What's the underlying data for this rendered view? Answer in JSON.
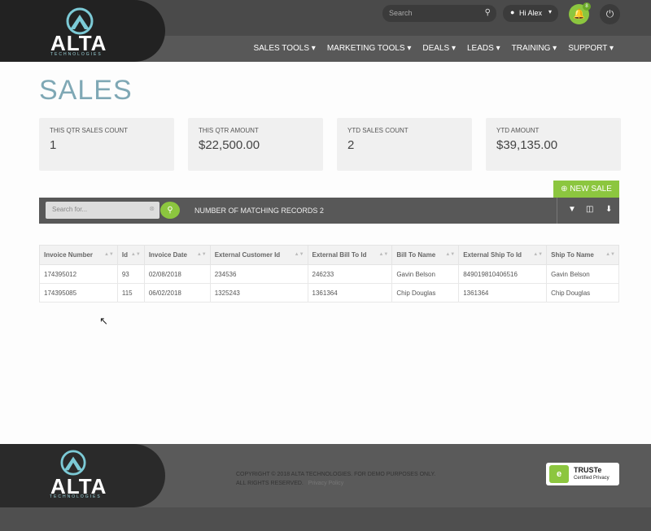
{
  "brand": {
    "name": "ALTA",
    "tagline": "TECHNOLOGIES",
    "accent": "#8cc63f",
    "title_color": "#7fa8b5"
  },
  "header": {
    "search_placeholder": "Search",
    "user_label": "Hi Alex",
    "notification_count": "8",
    "nav": [
      "SALES TOOLS",
      "MARKETING TOOLS",
      "DEALS",
      "LEADS",
      "TRAINING",
      "SUPPORT"
    ]
  },
  "page": {
    "title": "SALES",
    "new_sale_label": "NEW SALE"
  },
  "stats": [
    {
      "label": "THIS QTR SALES COUNT",
      "value": "1"
    },
    {
      "label": "THIS QTR AMOUNT",
      "value": "$22,500.00"
    },
    {
      "label": "YTD SALES COUNT",
      "value": "2"
    },
    {
      "label": "YTD AMOUNT",
      "value": "$39,135.00"
    }
  ],
  "toolbar": {
    "search_placeholder": "Search for...",
    "matching_text": "NUMBER OF MATCHING RECORDS 2"
  },
  "table": {
    "columns": [
      "Invoice Number",
      "Id",
      "Invoice Date",
      "External Customer Id",
      "External Bill To Id",
      "Bill To Name",
      "External Ship To Id",
      "Ship To Name"
    ],
    "rows": [
      [
        "174395012",
        "93",
        "02/08/2018",
        "234536",
        "246233",
        "Gavin Belson",
        "849019810406516",
        "Gavin Belson"
      ],
      [
        "174395085",
        "115",
        "06/02/2018",
        "1325243",
        "1361364",
        "Chip Douglas",
        "1361364",
        "Chip Douglas"
      ]
    ]
  },
  "footer": {
    "copyright_line1": "COPYRIGHT © 2018 ALTA TECHNOLOGIES. FOR DEMO PURPOSES ONLY.",
    "copyright_line2": "ALL RIGHTS RESERVED.",
    "privacy_label": "Privacy Policy",
    "truste_title": "TRUSTe",
    "truste_sub": "Certified Privacy"
  }
}
